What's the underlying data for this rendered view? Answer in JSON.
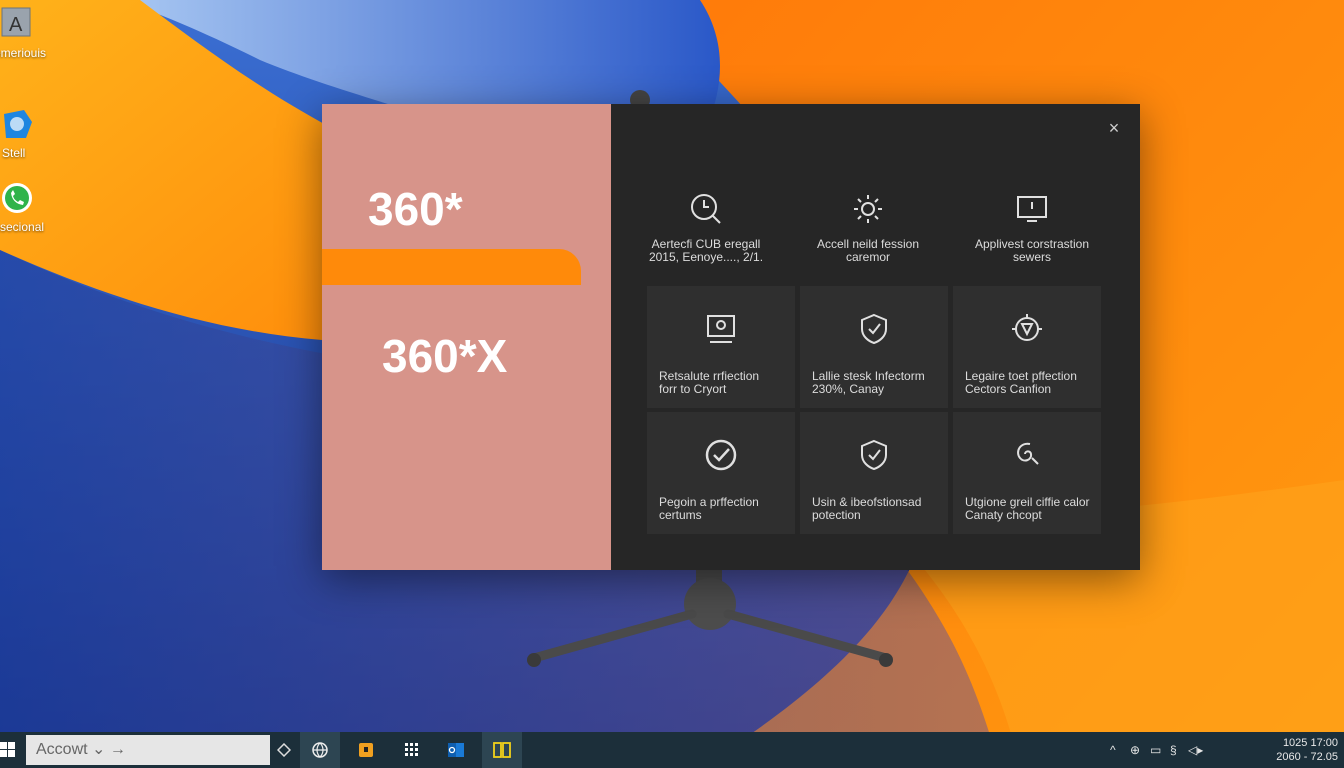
{
  "desktop": {
    "icons": [
      {
        "label": "emeriouis",
        "glyph": "A"
      },
      {
        "label": "Stell",
        "glyph": ""
      },
      {
        "label": "ssecional",
        "glyph": ""
      }
    ]
  },
  "window": {
    "left_panel": {
      "headline_top": "360*",
      "headline_bottom": "360*X",
      "colors": {
        "panel": "#d7948a",
        "band": "#ff8a0a"
      }
    },
    "close_label": "×",
    "tiles": [
      {
        "icon": "clock-search-icon",
        "text1": "Aertecfi CUB eregall",
        "text2": "2015, Eenoye...., 2/1."
      },
      {
        "icon": "gear-sparkle-icon",
        "text1": "Accell neild fession",
        "text2": "caremor"
      },
      {
        "icon": "monitor-alert-icon",
        "text1": "Applivest corstrastion",
        "text2": "sewers"
      },
      {
        "icon": "scan-shield-icon",
        "text1": "Retsalute rrfiection",
        "text2": "forr to Cryort"
      },
      {
        "icon": "shield-icon",
        "text1": "Lallie stesk Infectorm",
        "text2": "230%, Canay"
      },
      {
        "icon": "bug-cog-icon",
        "text1": "Legaire toet pffection",
        "text2": "Cectors Canfion"
      },
      {
        "icon": "check-circle-icon",
        "text1": "Pegoin a prffection",
        "text2": "certums"
      },
      {
        "icon": "shield-check-icon",
        "text1": "Usin & ibeofstionsad",
        "text2": "potection"
      },
      {
        "icon": "swirl-icon",
        "text1": "Utgione greil ciffie calor",
        "text2": "Canaty chcopt"
      }
    ]
  },
  "taskbar": {
    "search_text": "Accowt ⌄ →",
    "clock_top": "1025   17:00",
    "clock_bottom": "2060 - 72.05",
    "tray_texts": [
      "^",
      "⊕",
      "▭",
      "§",
      "◁▸"
    ]
  }
}
